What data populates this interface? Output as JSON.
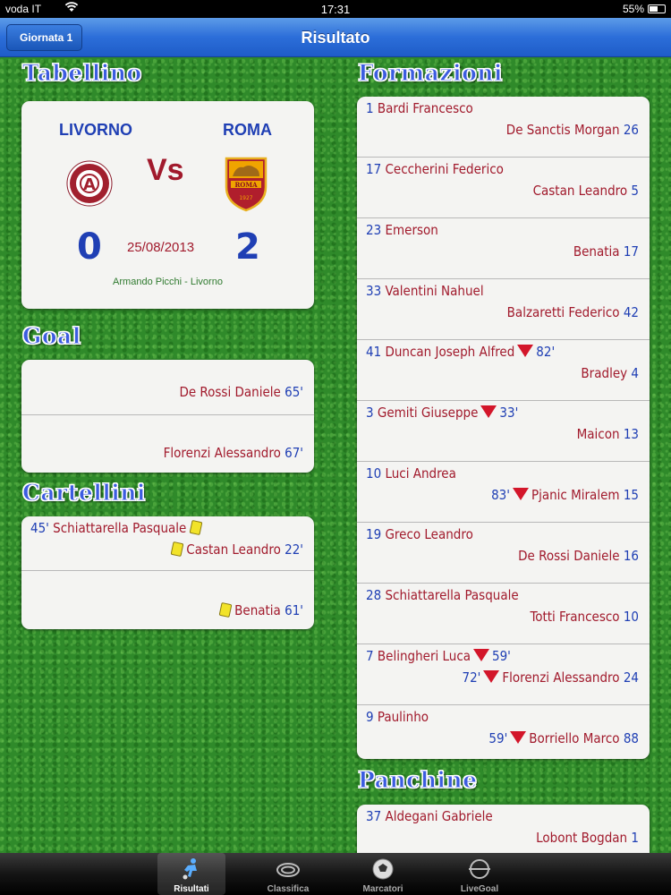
{
  "status": {
    "carrier": "voda IT",
    "time": "17:31",
    "battery": "55%",
    "battery_level": 0.55
  },
  "nav": {
    "back": "Giornata 1",
    "title": "Risultato"
  },
  "sections": {
    "tabellino": "Tabellino",
    "goal": "Goal",
    "cartellini": "Cartellini",
    "formazioni": "Formazioni",
    "panchine": "Panchine"
  },
  "match": {
    "home": "LIVORNO",
    "away": "ROMA",
    "vs": "Vs",
    "home_score": "0",
    "away_score": "2",
    "date": "25/08/2013",
    "venue": "Armando Picchi - Livorno",
    "home_crest_text": "A.S. LIVORNO CALCIO 1915",
    "away_crest_text": "ROMA 1927"
  },
  "goals": [
    {
      "player": "De Rossi Daniele",
      "minute": "65'"
    },
    {
      "player": "Florenzi Alessandro",
      "minute": "67'"
    }
  ],
  "cards": [
    {
      "home_minute": "45'",
      "home_player": "Schiattarella Pasquale",
      "away_player": "Castan Leandro",
      "away_minute": "22'"
    },
    {
      "away_player": "Benatia",
      "away_minute": "61'"
    }
  ],
  "lineups": [
    {
      "home_num": "1",
      "home": "Bardi Francesco",
      "away": "De Sanctis Morgan",
      "away_num": "26"
    },
    {
      "home_num": "17",
      "home": "Ceccherini Federico",
      "away": "Castan Leandro",
      "away_num": "5"
    },
    {
      "home_num": "23",
      "home": "Emerson",
      "away": "Benatia",
      "away_num": "17"
    },
    {
      "home_num": "33",
      "home": "Valentini Nahuel",
      "away": "Balzaretti Federico",
      "away_num": "42"
    },
    {
      "home_num": "41",
      "home": "Duncan Joseph Alfred",
      "home_sub": "82'",
      "away": "Bradley",
      "away_num": "4"
    },
    {
      "home_num": "3",
      "home": "Gemiti Giuseppe",
      "home_sub": "33'",
      "away": "Maicon",
      "away_num": "13"
    },
    {
      "home_num": "10",
      "home": "Luci Andrea",
      "away_sub": "83'",
      "away": "Pjanic Miralem",
      "away_num": "15"
    },
    {
      "home_num": "19",
      "home": "Greco Leandro",
      "away": "De Rossi Daniele",
      "away_num": "16"
    },
    {
      "home_num": "28",
      "home": "Schiattarella Pasquale",
      "away": "Totti Francesco",
      "away_num": "10"
    },
    {
      "home_num": "7",
      "home": "Belingheri Luca",
      "home_sub": "59'",
      "away_sub": "72'",
      "away": "Florenzi Alessandro",
      "away_num": "24"
    },
    {
      "home_num": "9",
      "home": "Paulinho",
      "away_sub": "59'",
      "away": "Borriello Marco",
      "away_num": "88"
    }
  ],
  "bench": [
    {
      "home_num": "37",
      "home": "Aldegani Gabriele",
      "away": "Lobont Bogdan",
      "away_num": "1"
    }
  ],
  "tabs": [
    {
      "label": "Risultati"
    },
    {
      "label": "Classifica"
    },
    {
      "label": "Marcatori"
    },
    {
      "label": "LiveGoal"
    }
  ]
}
